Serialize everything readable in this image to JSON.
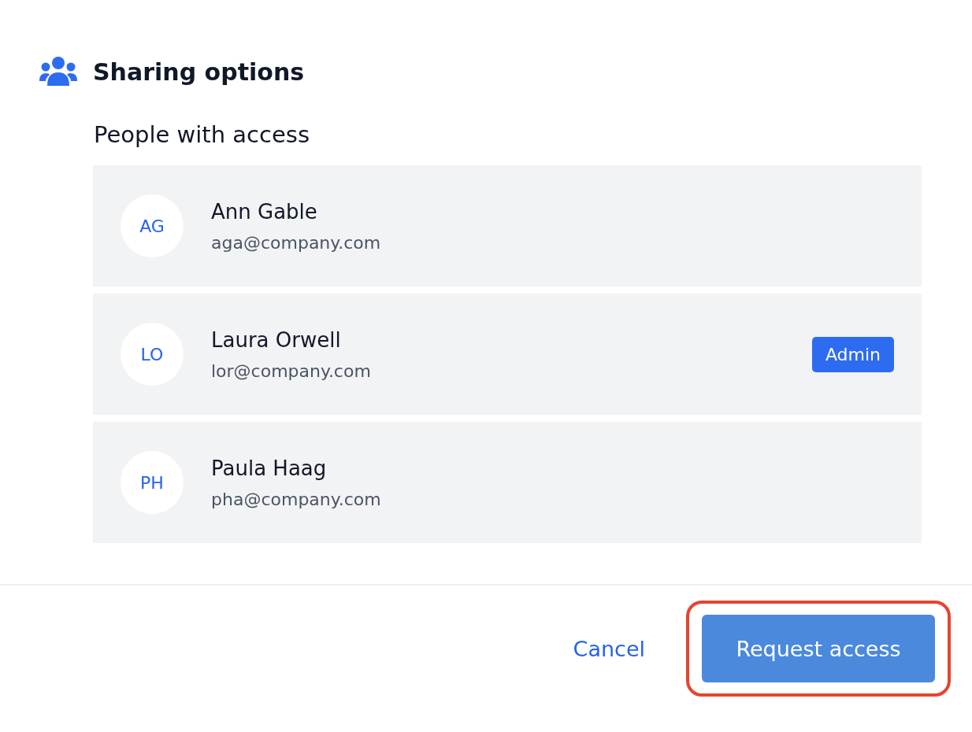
{
  "header": {
    "title": "Sharing options"
  },
  "section": {
    "title": "People with access"
  },
  "people": [
    {
      "initials": "AG",
      "name": "Ann Gable",
      "email": "aga@company.com"
    },
    {
      "initials": "LO",
      "name": "Laura Orwell",
      "email": "lor@company.com",
      "badge": "Admin"
    },
    {
      "initials": "PH",
      "name": "Paula Haag",
      "email": "pha@company.com"
    }
  ],
  "footer": {
    "cancel": "Cancel",
    "primary": {
      "label": "Request access",
      "highlighted": true
    }
  }
}
